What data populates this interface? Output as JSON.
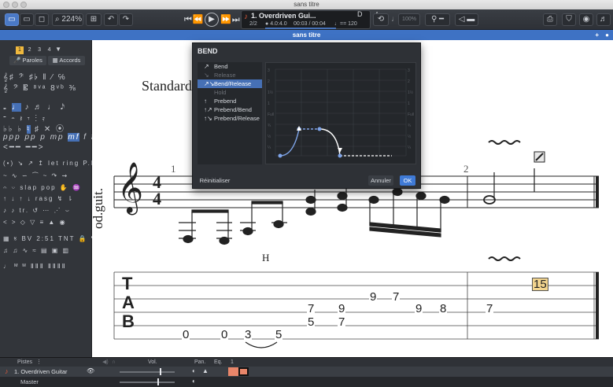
{
  "window": {
    "title": "sans titre"
  },
  "toolbar": {
    "zoom": "224%",
    "track_name": "1. Overdriven Gui...",
    "bar_position": "2/2",
    "time_signature": "4.0:4.0",
    "time_position": "00:03 / 00:04",
    "tempo_value": "= 120",
    "key": "D",
    "volume": "100%"
  },
  "document_tab": {
    "title": "sans titre"
  },
  "palette": {
    "voices": [
      "1",
      "2",
      "3",
      "4"
    ],
    "lyrics_label": "Paroles",
    "chords_label": "Accords"
  },
  "bend_dialog": {
    "title": "BEND",
    "items": [
      {
        "label": "Bend",
        "icon": "↗",
        "state": "normal"
      },
      {
        "label": "Release",
        "icon": "↘",
        "state": "disabled"
      },
      {
        "label": "Bend/Release",
        "icon": "↗↘",
        "state": "selected"
      },
      {
        "label": "Hold",
        "icon": "",
        "state": "disabled"
      },
      {
        "label": "Prebend",
        "icon": "↑",
        "state": "normal"
      },
      {
        "label": "Prebend/Bend",
        "icon": "↑↗",
        "state": "normal"
      },
      {
        "label": "Prebend/Release",
        "icon": "↑↘",
        "state": "normal"
      }
    ],
    "graph_labels": [
      "3",
      "2",
      "1½",
      "1",
      "Full",
      "¾",
      "½",
      "¼"
    ],
    "reset_label": "Réinitialiser",
    "cancel_label": "Annuler",
    "ok_label": "OK"
  },
  "score": {
    "tuning_text": "Standard",
    "instrument_label": "od.guit.",
    "measure_1": "1",
    "measure_2": "2",
    "hammer_label": "H",
    "tab_clef": [
      "T",
      "A",
      "B"
    ],
    "tab_numbers": {
      "low": [
        "0",
        "0",
        "3",
        "5"
      ],
      "chord1": [
        "7",
        "5"
      ],
      "chord2": [
        "9",
        "7"
      ],
      "high_a": "9",
      "high_b": "7",
      "mid_a": "9",
      "mid_b": "8",
      "m2": "7",
      "bend": "15"
    }
  },
  "bottom_panel": {
    "tracks_label": "Pistes",
    "vol_label": "Vol.",
    "pan_label": "Pan.",
    "eq_label": "Eq.",
    "eq_value": "1",
    "track_1": "1. Overdriven Guitar",
    "master": "Master"
  },
  "colors": {
    "accent": "#4670b5",
    "tab_bar": "#3e72c4",
    "bend_highlight": "#f3d58f"
  }
}
